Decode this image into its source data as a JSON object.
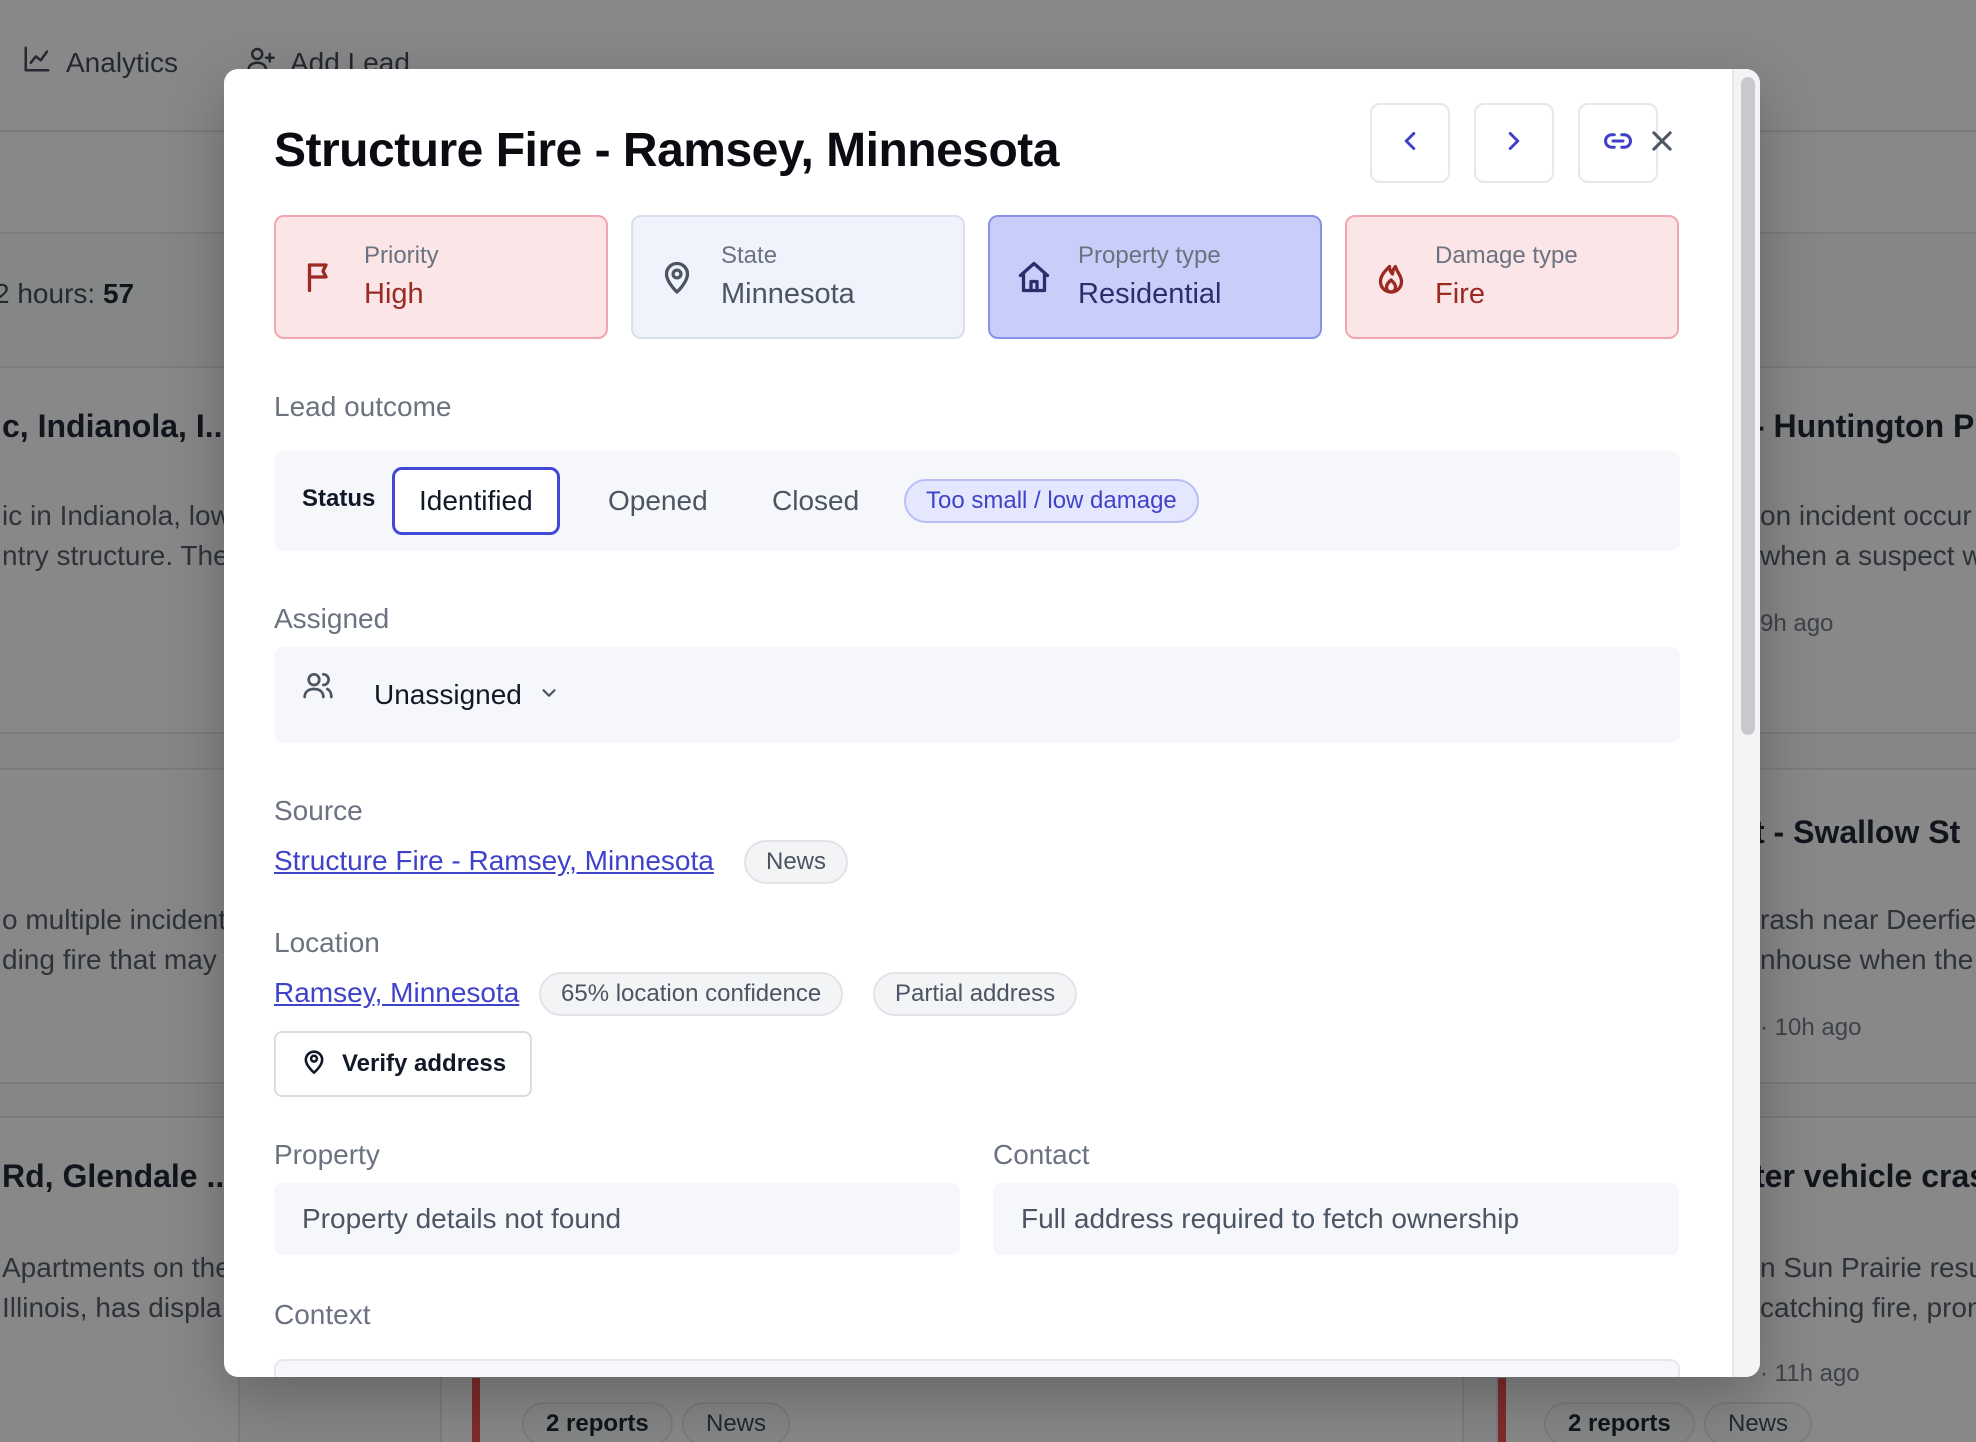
{
  "background": {
    "nav": [
      {
        "label": "Analytics",
        "icon": "chart-line-icon"
      },
      {
        "label": "Add Lead",
        "icon": "user-plus-icon"
      }
    ],
    "stat_prefix": "2 hours: ",
    "stat_value": "57",
    "cards": {
      "left1": {
        "title": "c, Indianola, I...",
        "line1": "ic in Indianola, low",
        "line2": "ntry structure. The"
      },
      "left2": {
        "line1": "o multiple incident",
        "line2": "ding fire that may"
      },
      "left3": {
        "title": "Rd, Glendale ...",
        "line1": "Apartments on the",
        "line2": "Illinois, has displa"
      },
      "right1": {
        "title": " - Huntington P",
        "line1": "on incident occur",
        "line2": "when a suspect w",
        "meta": "9h ago"
      },
      "right2": {
        "title": "t - Swallow St",
        "line1": "rash near Deerfie",
        "line2": "nhouse when the",
        "meta": "· 10h ago"
      },
      "right3": {
        "title": "ter vehicle cras",
        "line1": "n Sun Prairie resu",
        "line2": "catching fire, pron",
        "meta": "· 11h ago",
        "reports": "2 reports",
        "tag": "News"
      },
      "mid_bottom": {
        "reports": "2 reports",
        "tag": "News"
      }
    }
  },
  "modal": {
    "title": "Structure Fire - Ramsey, Minnesota",
    "buttons": {
      "prev": "chevron-left-icon",
      "next": "chevron-right-icon",
      "link": "link-icon",
      "close": "close-icon"
    },
    "info_cards": [
      {
        "label": "Priority",
        "value": "High",
        "icon": "flag-icon"
      },
      {
        "label": "State",
        "value": "Minnesota",
        "icon": "map-pin-icon"
      },
      {
        "label": "Property type",
        "value": "Residential",
        "icon": "home-icon"
      },
      {
        "label": "Damage type",
        "value": "Fire",
        "icon": "flame-icon"
      }
    ],
    "lead_outcome": {
      "heading": "Lead outcome",
      "status_label": "Status",
      "options": [
        "Identified",
        "Opened",
        "Closed"
      ],
      "selected": "Identified",
      "tag": "Too small / low damage"
    },
    "assigned": {
      "heading": "Assigned",
      "value": "Unassigned"
    },
    "source": {
      "heading": "Source",
      "link": "Structure Fire - Ramsey, Minnesota",
      "chip": "News"
    },
    "location": {
      "heading": "Location",
      "link": "Ramsey, Minnesota",
      "chips": [
        "65% location confidence",
        "Partial address"
      ],
      "verify_button": "Verify address"
    },
    "property": {
      "heading": "Property",
      "text": "Property details not found"
    },
    "contact": {
      "heading": "Contact",
      "text": "Full address required to fetch ownership"
    },
    "context": {
      "heading": "Context"
    }
  }
}
